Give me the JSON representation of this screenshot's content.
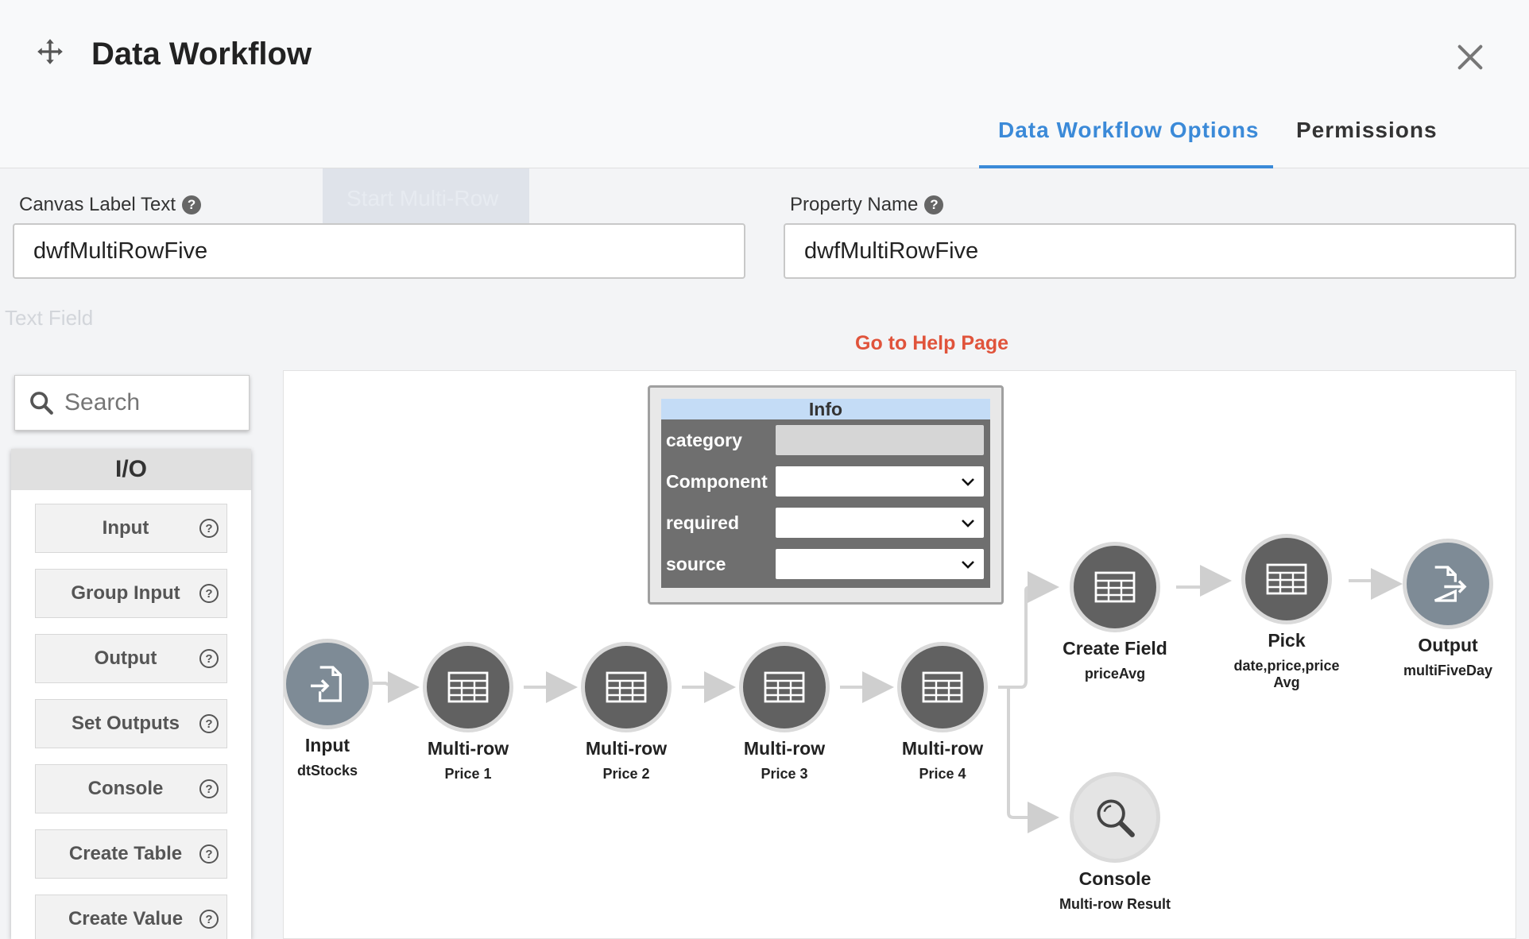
{
  "header": {
    "title": "Data Workflow",
    "tabs": [
      {
        "label": "Data Workflow Options",
        "active": true
      },
      {
        "label": "Permissions",
        "active": false
      }
    ]
  },
  "form": {
    "canvas_label": {
      "label": "Canvas Label Text",
      "value": "dwfMultiRowFive"
    },
    "property_name": {
      "label": "Property Name",
      "value": "dwfMultiRowFive"
    },
    "help_link": "Go to Help Page"
  },
  "palette": {
    "search_placeholder": "Search",
    "section": "I/O",
    "items": [
      "Input",
      "Group Input",
      "Output",
      "Set Outputs",
      "Console",
      "Create Table",
      "Create Value"
    ]
  },
  "info_panel": {
    "title": "Info",
    "rows": [
      {
        "key": "category",
        "value": ""
      },
      {
        "key": "Component",
        "value": ""
      },
      {
        "key": "required",
        "value": ""
      },
      {
        "key": "source",
        "value": ""
      }
    ]
  },
  "nodes": [
    {
      "title": "Input",
      "sub": "dtStocks",
      "icon": "file-input-icon"
    },
    {
      "title": "Multi-row",
      "sub": "Price 1",
      "icon": "table-icon"
    },
    {
      "title": "Multi-row",
      "sub": "Price 2",
      "icon": "table-icon"
    },
    {
      "title": "Multi-row",
      "sub": "Price 3",
      "icon": "table-icon"
    },
    {
      "title": "Multi-row",
      "sub": "Price 4",
      "icon": "table-icon"
    },
    {
      "title": "Create Field",
      "sub": "priceAvg",
      "icon": "table-icon"
    },
    {
      "title": "Pick",
      "sub": "date,price,price Avg",
      "icon": "table-icon"
    },
    {
      "title": "Output",
      "sub": "multiFiveDay",
      "icon": "file-output-icon"
    },
    {
      "title": "Console",
      "sub": "Multi-row Result",
      "icon": "magnifier-icon"
    }
  ],
  "colors": {
    "accent": "#3b8ad8",
    "link": "#e0533b",
    "node_dark": "#616161",
    "info_header": "#c4dcf6"
  }
}
